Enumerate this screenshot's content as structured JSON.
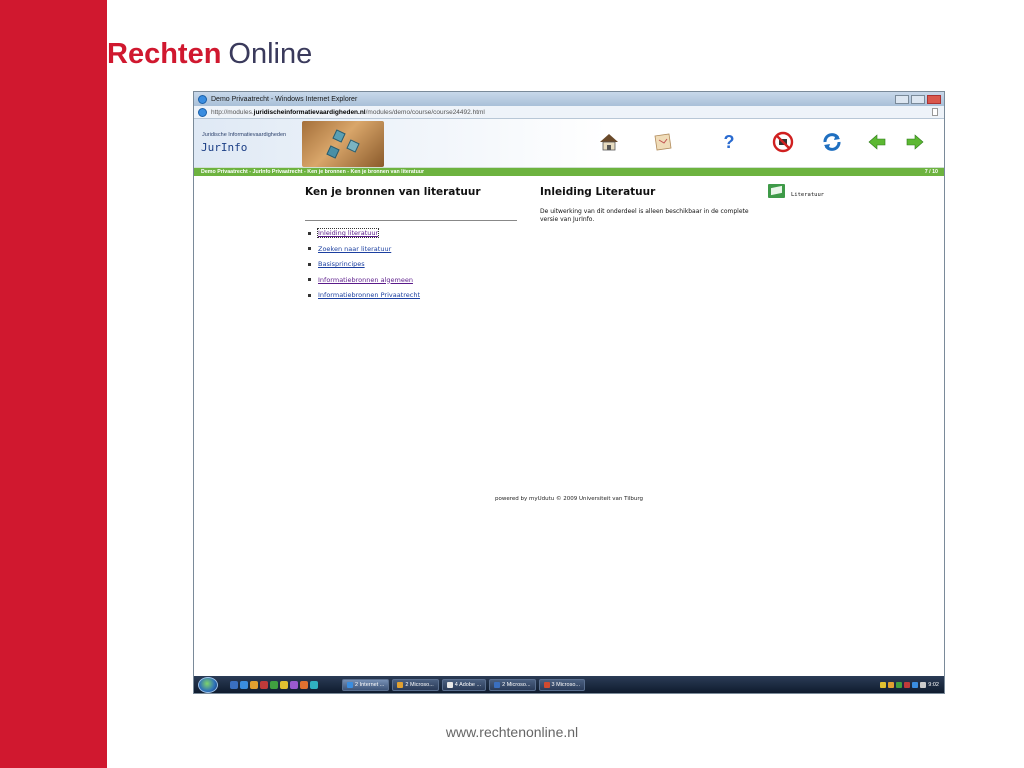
{
  "slide": {
    "brand_red": "Rechten",
    "brand_dark": "Online",
    "footer_url": "www.rechtenonline.nl",
    "colors": {
      "red": "#d0182f",
      "dark": "#3a3a5c"
    }
  },
  "window": {
    "title": "Demo Privaatrecht - Windows Internet Explorer",
    "url_prefix": "http://modules.",
    "url_domain": "juridischeinformatievaardigheden.nl",
    "url_path": "/modules/demo/course/course24492.html"
  },
  "header": {
    "subtitle": "Juridische Informatievaardigheden",
    "title": "JurInfo",
    "toolbar_icons": [
      "home-icon",
      "map-icon",
      "help-icon",
      "no-audio-icon",
      "refresh-icon",
      "back-arrow-icon",
      "forward-arrow-icon"
    ],
    "help_glyph": "?"
  },
  "breadcrumb": {
    "path": "Demo Privaatrecht - JurInfo Privaatrecht - Ken je bronnen - Ken je bronnen van literatuur",
    "page": "7 / 10"
  },
  "left": {
    "title": "Ken je bronnen van literatuur",
    "items": [
      "Inleiding literatuur",
      "Zoeken naar literatuur",
      "Basisprincipes",
      "Informatiebronnen algemeen",
      "Informatiebronnen Privaatrecht"
    ]
  },
  "main": {
    "title": "Inleiding Literatuur",
    "text": "De uitwerking van dit onderdeel is alleen beschikbaar in de complete versie van JurInfo.",
    "resource_label": "Literatuur"
  },
  "footer": {
    "powered": "powered by myUdutu     © 2009 Universiteit van Tilburg"
  },
  "taskbar": {
    "tasks": [
      "2 Internet ...",
      "2 Microso...",
      "4 Adobe ...",
      "2 Microso...",
      "3 Microso..."
    ],
    "clock": "9:02"
  }
}
